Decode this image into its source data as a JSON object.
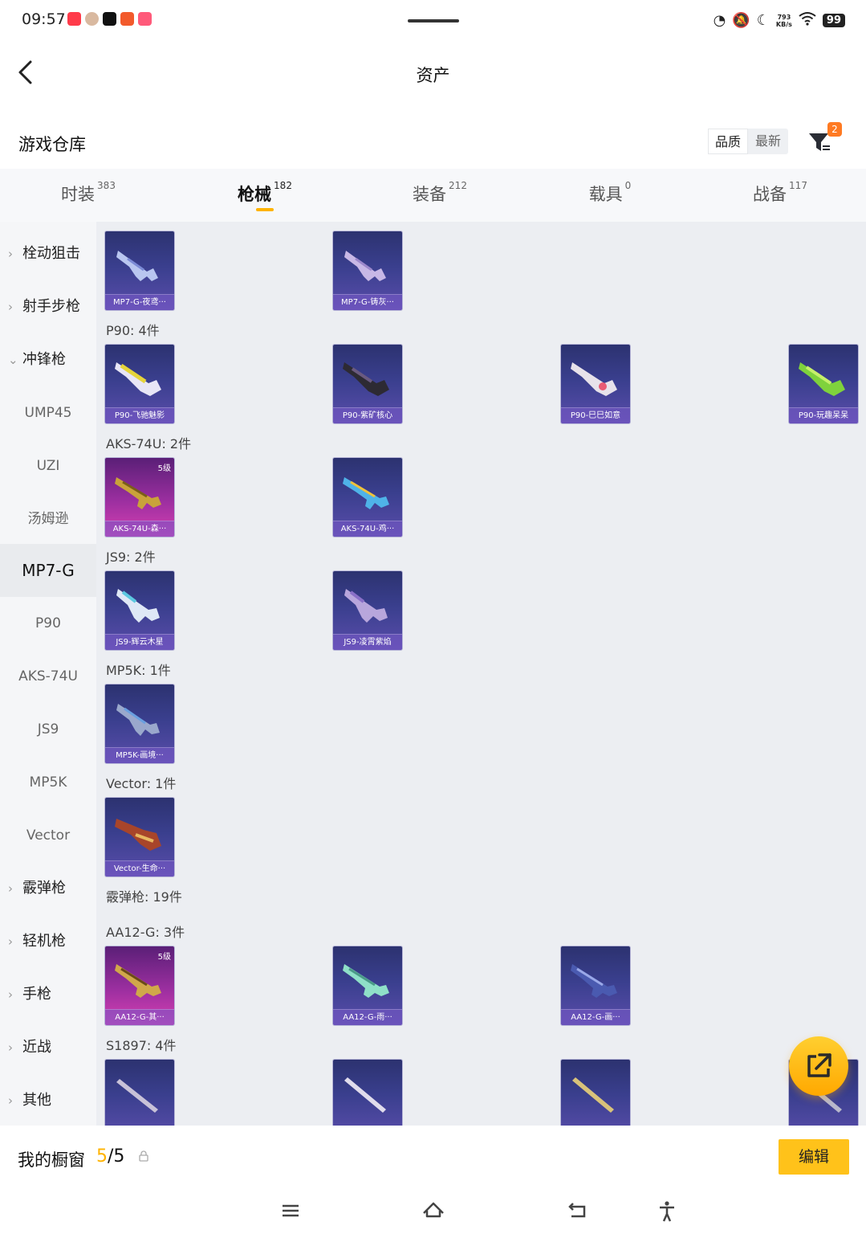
{
  "status": {
    "time": "09:57",
    "net_speed_value": "793",
    "net_speed_unit": "KB/s",
    "battery": "99"
  },
  "header": {
    "title": "资产"
  },
  "warehouse": {
    "title": "游戏仓库",
    "sort_options": [
      "品质",
      "最新"
    ],
    "filter_badge": "2"
  },
  "tabs": [
    {
      "label": "时装",
      "count": "383"
    },
    {
      "label": "枪械",
      "count": "182"
    },
    {
      "label": "装备",
      "count": "212"
    },
    {
      "label": "载具",
      "count": "0"
    },
    {
      "label": "战备",
      "count": "117"
    }
  ],
  "sidebar": {
    "items": [
      {
        "label": "栓动狙击",
        "type": "cat",
        "chevron": "›"
      },
      {
        "label": "射手步枪",
        "type": "cat",
        "chevron": "›"
      },
      {
        "label": "冲锋枪",
        "type": "cat",
        "chevron": "⌄"
      },
      {
        "label": "UMP45",
        "type": "sub"
      },
      {
        "label": "UZI",
        "type": "sub"
      },
      {
        "label": "汤姆逊",
        "type": "sub"
      },
      {
        "label": "MP7-G",
        "type": "sub"
      },
      {
        "label": "P90",
        "type": "sub"
      },
      {
        "label": "AKS-74U",
        "type": "sub"
      },
      {
        "label": "JS9",
        "type": "sub"
      },
      {
        "label": "MP5K",
        "type": "sub"
      },
      {
        "label": "Vector",
        "type": "sub"
      },
      {
        "label": "霰弹枪",
        "type": "cat",
        "chevron": "›"
      },
      {
        "label": "轻机枪",
        "type": "cat",
        "chevron": "›"
      },
      {
        "label": "手枪",
        "type": "cat",
        "chevron": "›"
      },
      {
        "label": "近战",
        "type": "cat",
        "chevron": "›"
      },
      {
        "label": "其他",
        "type": "cat",
        "chevron": "›"
      }
    ]
  },
  "groups": {
    "mp7g": {
      "cards": [
        {
          "name": "MP7-G-夜鸢···"
        },
        {
          "name": "MP7-G-铸灰···"
        }
      ]
    },
    "p90": {
      "label": "P90: 4件",
      "cards": [
        {
          "name": "P90-飞驰魅影"
        },
        {
          "name": "P90-紫矿核心"
        },
        {
          "name": "P90-巳巳如意"
        },
        {
          "name": "P90-玩趣呆呆"
        }
      ]
    },
    "aks": {
      "label": "AKS-74U: 2件",
      "cards": [
        {
          "name": "AKS-74U-森···",
          "level": "5级"
        },
        {
          "name": "AKS-74U-鸡···"
        }
      ]
    },
    "js9": {
      "label": "JS9: 2件",
      "cards": [
        {
          "name": "JS9-辉云木星"
        },
        {
          "name": "JS9-凌霄紫焰"
        }
      ]
    },
    "mp5k": {
      "label": "MP5K: 1件",
      "cards": [
        {
          "name": "MP5K-画境···"
        }
      ]
    },
    "vector": {
      "label": "Vector: 1件",
      "cards": [
        {
          "name": "Vector-生命···"
        }
      ]
    },
    "shotgun": {
      "label": "霰弹枪: 19件"
    },
    "aa12": {
      "label": "AA12-G: 3件",
      "cards": [
        {
          "name": "AA12-G-其···",
          "level": "5级"
        },
        {
          "name": "AA12-G-雨···"
        },
        {
          "name": "AA12-G-画···"
        }
      ]
    },
    "s1897": {
      "label": "S1897: 4件"
    }
  },
  "showcase": {
    "label": "我的橱窗",
    "current": "5",
    "total": "/5",
    "edit_label": "编辑"
  }
}
